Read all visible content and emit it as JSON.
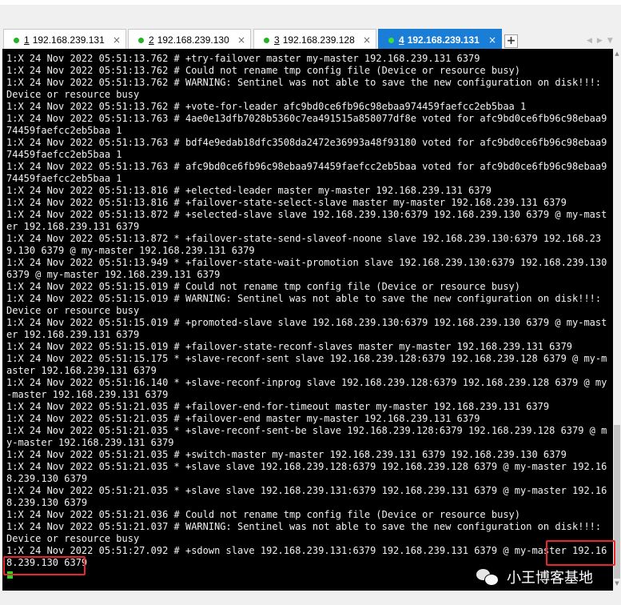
{
  "tabs": [
    {
      "num": "1",
      "host": "192.168.239.131",
      "active": false
    },
    {
      "num": "2",
      "host": "192.168.239.130",
      "active": false
    },
    {
      "num": "3",
      "host": "192.168.239.128",
      "active": false
    },
    {
      "num": "4",
      "host": "192.168.239.131",
      "active": true
    }
  ],
  "tab_close_glyph": "×",
  "add_tab_glyph": "+",
  "nav_arrows": "◀▶▼",
  "terminal_lines": [
    "1:X 24 Nov 2022 05:51:13.762 # +try-failover master my-master 192.168.239.131 6379",
    "1:X 24 Nov 2022 05:51:13.762 # Could not rename tmp config file (Device or resource busy)",
    "1:X 24 Nov 2022 05:51:13.762 # WARNING: Sentinel was not able to save the new configuration on disk!!!: Device or resource busy",
    "1:X 24 Nov 2022 05:51:13.762 # +vote-for-leader afc9bd0ce6fb96c98ebaa974459faefcc2eb5baa 1",
    "1:X 24 Nov 2022 05:51:13.763 # 4ae0e13dfb7028b5360c7ea491515a858077df8e voted for afc9bd0ce6fb96c98ebaa974459faefcc2eb5baa 1",
    "1:X 24 Nov 2022 05:51:13.763 # bdf4e9edab18dfc3508da2472e36993a48f93180 voted for afc9bd0ce6fb96c98ebaa974459faefcc2eb5baa 1",
    "1:X 24 Nov 2022 05:51:13.763 # afc9bd0ce6fb96c98ebaa974459faefcc2eb5baa voted for afc9bd0ce6fb96c98ebaa974459faefcc2eb5baa 1",
    "1:X 24 Nov 2022 05:51:13.816 # +elected-leader master my-master 192.168.239.131 6379",
    "1:X 24 Nov 2022 05:51:13.816 # +failover-state-select-slave master my-master 192.168.239.131 6379",
    "1:X 24 Nov 2022 05:51:13.872 # +selected-slave slave 192.168.239.130:6379 192.168.239.130 6379 @ my-master 192.168.239.131 6379",
    "1:X 24 Nov 2022 05:51:13.872 * +failover-state-send-slaveof-noone slave 192.168.239.130:6379 192.168.239.130 6379 @ my-master 192.168.239.131 6379",
    "1:X 24 Nov 2022 05:51:13.949 * +failover-state-wait-promotion slave 192.168.239.130:6379 192.168.239.130 6379 @ my-master 192.168.239.131 6379",
    "1:X 24 Nov 2022 05:51:15.019 # Could not rename tmp config file (Device or resource busy)",
    "1:X 24 Nov 2022 05:51:15.019 # WARNING: Sentinel was not able to save the new configuration on disk!!!: Device or resource busy",
    "1:X 24 Nov 2022 05:51:15.019 # +promoted-slave slave 192.168.239.130:6379 192.168.239.130 6379 @ my-master 192.168.239.131 6379",
    "1:X 24 Nov 2022 05:51:15.019 # +failover-state-reconf-slaves master my-master 192.168.239.131 6379",
    "1:X 24 Nov 2022 05:51:15.175 * +slave-reconf-sent slave 192.168.239.128:6379 192.168.239.128 6379 @ my-master 192.168.239.131 6379",
    "1:X 24 Nov 2022 05:51:16.140 * +slave-reconf-inprog slave 192.168.239.128:6379 192.168.239.128 6379 @ my-master 192.168.239.131 6379",
    "1:X 24 Nov 2022 05:51:21.035 # +failover-end-for-timeout master my-master 192.168.239.131 6379",
    "1:X 24 Nov 2022 05:51:21.035 # +failover-end master my-master 192.168.239.131 6379",
    "1:X 24 Nov 2022 05:51:21.035 * +slave-reconf-sent-be slave 192.168.239.128:6379 192.168.239.128 6379 @ my-master 192.168.239.131 6379",
    "1:X 24 Nov 2022 05:51:21.035 # +switch-master my-master 192.168.239.131 6379 192.168.239.130 6379",
    "1:X 24 Nov 2022 05:51:21.035 * +slave slave 192.168.239.128:6379 192.168.239.128 6379 @ my-master 192.168.239.130 6379",
    "1:X 24 Nov 2022 05:51:21.035 * +slave slave 192.168.239.131:6379 192.168.239.131 6379 @ my-master 192.168.239.130 6379",
    "1:X 24 Nov 2022 05:51:21.036 # Could not rename tmp config file (Device or resource busy)",
    "1:X 24 Nov 2022 05:51:21.037 # WARNING: Sentinel was not able to save the new configuration on disk!!!: Device or resource busy",
    "1:X 24 Nov 2022 05:51:27.092 # +sdown slave 192.168.239.131:6379 192.168.239.131 6379 @ my-master 192.168.239.130 6379"
  ],
  "watermark_text": "小王博客基地",
  "colors": {
    "terminal_bg": "#000000",
    "terminal_fg": "#f2f2f2",
    "active_tab": "#1a7ed6",
    "connected_dot": "#22b422",
    "highlight_box": "#e8262b",
    "cursor": "#22dd22"
  }
}
